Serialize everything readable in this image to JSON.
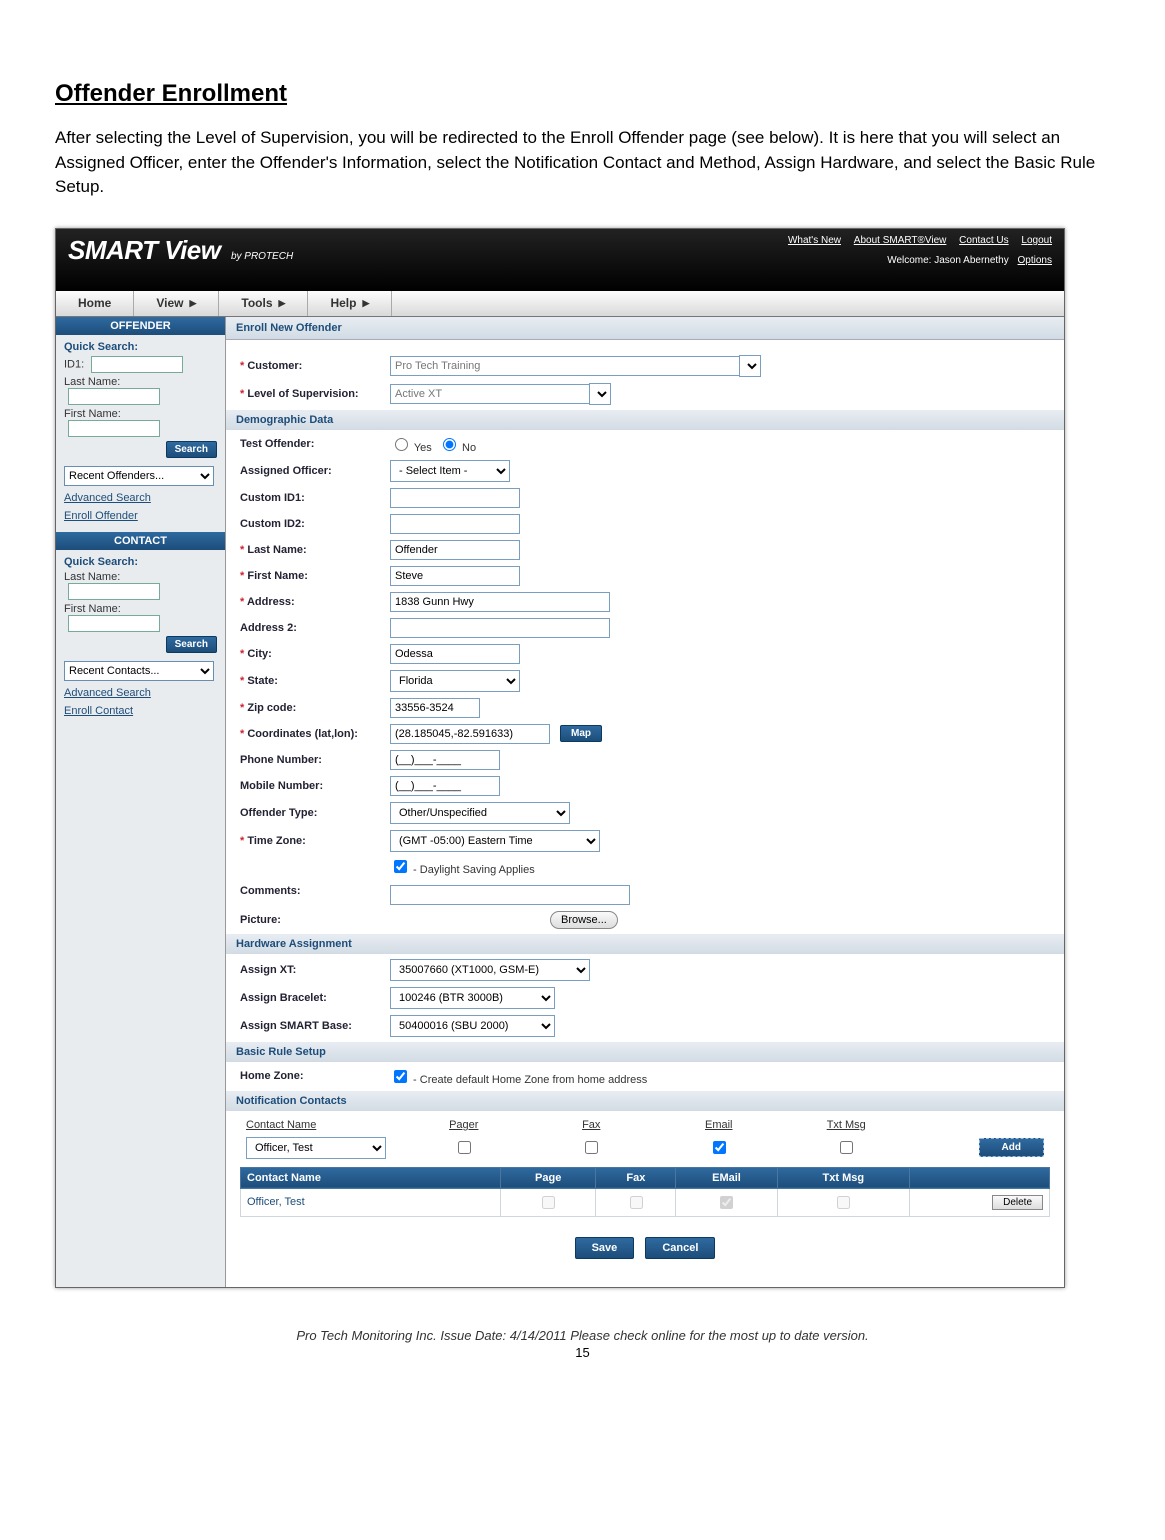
{
  "doc": {
    "title": "Offender Enrollment",
    "intro": "After selecting the Level of Supervision, you will be redirected to the Enroll Offender page (see below). It is here that you will select an Assigned Officer, enter the Offender's Information, select the Notification Contact and Method, Assign Hardware, and select the Basic Rule Setup.",
    "footer": "Pro Tech Monitoring Inc. Issue Date: 4/14/2011 Please check online for the most up to date version.",
    "page_number": "15"
  },
  "header": {
    "logo_main": "SMART View",
    "logo_sub": "by PROTECH",
    "links": [
      "What's New",
      "About SMART®View",
      "Contact Us",
      "Logout"
    ],
    "welcome_label": "Welcome: Jason Abernethy",
    "options_link": "Options"
  },
  "menu": {
    "items": [
      "Home",
      "View",
      " ",
      "Tools",
      " ",
      "Help",
      " "
    ]
  },
  "sidebar": {
    "offender_header": "OFFENDER",
    "quick_search": "Quick Search:",
    "id1": "ID1:",
    "last_name": "Last Name:",
    "first_name": "First Name:",
    "search_btn": "Search",
    "recent_off": "Recent Offenders...",
    "adv_search": "Advanced Search",
    "enroll_off": "Enroll Offender",
    "contact_header": "CONTACT",
    "recent_cont": "Recent Contacts...",
    "enroll_cont": "Enroll Contact"
  },
  "form": {
    "title": "Enroll New Offender",
    "customer_label": "Customer:",
    "customer_value": "Pro Tech Training",
    "los_label": "Level of Supervision:",
    "los_value": "Active XT",
    "section_demo": "Demographic Data",
    "test_off_label": "Test Offender:",
    "test_yes": "Yes",
    "test_no": "No",
    "assigned_officer_label": "Assigned Officer:",
    "assigned_officer_value": "- Select Item -",
    "custom_id1_label": "Custom ID1:",
    "custom_id2_label": "Custom ID2:",
    "lname_label": "Last Name:",
    "lname_value": "Offender",
    "fname_label": "First Name:",
    "fname_value": "Steve",
    "addr_label": "Address:",
    "addr_value": "1838 Gunn Hwy",
    "addr2_label": "Address 2:",
    "city_label": "City:",
    "city_value": "Odessa",
    "state_label": "State:",
    "state_value": "Florida",
    "zip_label": "Zip code:",
    "zip_value": "33556-3524",
    "coord_label": "Coordinates (lat,lon):",
    "coord_value": "(28.185045,-82.591633)",
    "map_btn": "Map",
    "phone_label": "Phone Number:",
    "phone_value": "(__)___-____",
    "mobile_label": "Mobile Number:",
    "mobile_value": "(__)___-____",
    "otype_label": "Offender Type:",
    "otype_value": "Other/Unspecified",
    "tz_label": "Time Zone:",
    "tz_value": "(GMT -05:00) Eastern Time",
    "dst_label": " - Daylight Saving Applies",
    "comments_label": "Comments:",
    "picture_label": "Picture:",
    "browse_btn": "Browse...",
    "section_hw": "Hardware Assignment",
    "assign_xt_label": "Assign XT:",
    "assign_xt_value": "35007660 (XT1000, GSM-E)",
    "assign_br_label": "Assign Bracelet:",
    "assign_br_value": "100246 (BTR 3000B)",
    "assign_sb_label": "Assign SMART Base:",
    "assign_sb_value": "50400016 (SBU 2000)",
    "section_rule": "Basic Rule Setup",
    "home_zone_label": "Home Zone:",
    "home_zone_text": " - Create default Home Zone from home address",
    "section_notif": "Notification Contacts",
    "notif_cols": {
      "name": "Contact Name",
      "pager": "Pager",
      "fax": "Fax",
      "email": "Email",
      "txt": "Txt Msg"
    },
    "officer_value": "Officer, Test",
    "add_btn": "Add",
    "tbl_hdr": {
      "name": "Contact Name",
      "page": "Page",
      "fax": "Fax",
      "email": "EMail",
      "txt": "Txt Msg"
    },
    "row_officer": "Officer, Test",
    "delete_btn": "Delete",
    "save_btn": "Save",
    "cancel_btn": "Cancel"
  }
}
